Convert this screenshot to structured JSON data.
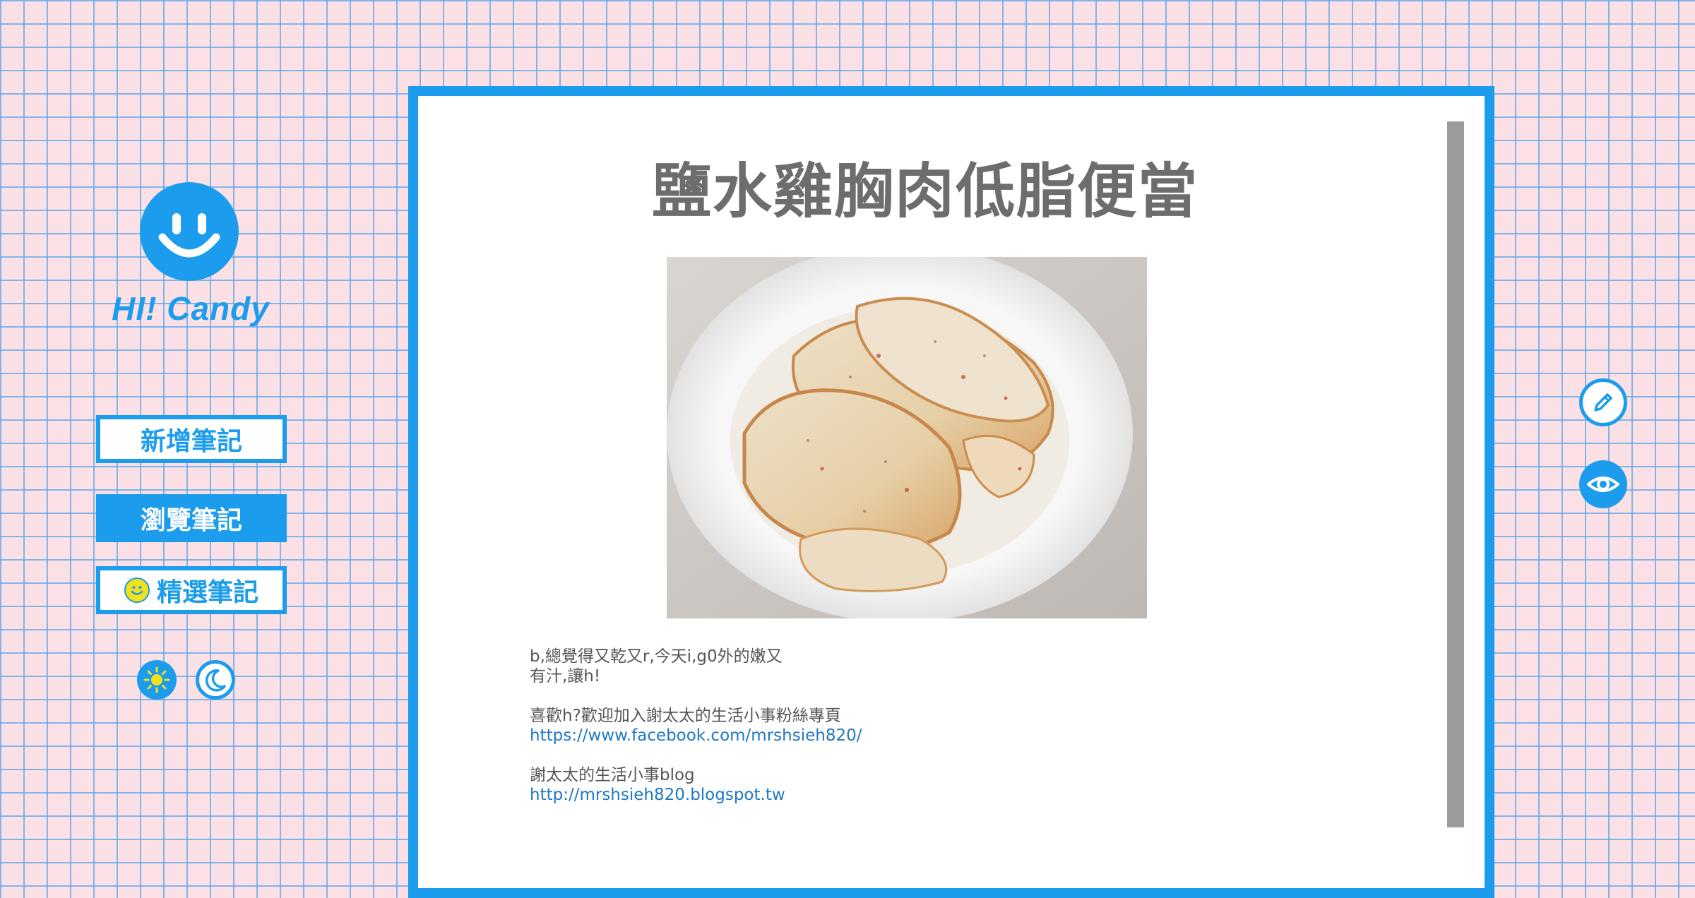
{
  "brand": {
    "name": "HI! Candy",
    "logo_icon": "smiley-face-icon"
  },
  "nav": {
    "add_note": "新增筆記",
    "browse_notes": "瀏覽筆記",
    "featured_notes": "精選筆記"
  },
  "theme": {
    "light_icon": "sun-icon",
    "dark_icon": "moon-icon"
  },
  "note": {
    "title": "鹽水雞胸肉低脂便當",
    "image_icon": "chicken-breast-photo",
    "body": {
      "line1": "b,總覺得又乾又r,今天i,g0外的嫩又",
      "line2": "有汁,讓h!",
      "line3": "喜歡h?歡迎加入謝太太的生活小事粉絲專頁",
      "link1": "https://www.facebook.com/mrshsieh820/",
      "line4": "謝太太的生活小事blog",
      "link2": "http://mrshsieh820.blogspot.tw"
    }
  },
  "actions": {
    "edit_icon": "pencil-icon",
    "view_icon": "eye-icon"
  },
  "colors": {
    "accent": "#1b9cec",
    "background": "#fbe1e6",
    "grid": "#5aa5eb"
  }
}
